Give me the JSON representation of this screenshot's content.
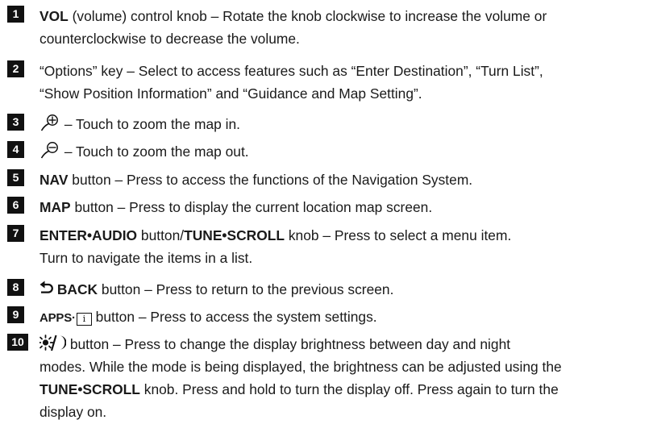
{
  "items": [
    {
      "num": "1",
      "bold": "VOL",
      "text": " (volume) control knob – Rotate the knob clockwise to increase the volume or",
      "text2": "counterclockwise to decrease the volume."
    },
    {
      "num": "2",
      "text": "“Options” key – Select to access features such as “Enter Destination”, “Turn List”,",
      "text2": "“Show Position Information” and “Guidance and Map Setting”."
    },
    {
      "num": "3",
      "icon": "zoom-in-icon",
      "text": " – Touch to zoom the map in."
    },
    {
      "num": "4",
      "icon": "zoom-out-icon",
      "text": " – Touch to zoom the map out."
    },
    {
      "num": "5",
      "bold": "NAV",
      "text": " button – Press to access the functions of the Navigation System."
    },
    {
      "num": "6",
      "bold": "MAP",
      "text": " button – Press to display the current location map screen."
    },
    {
      "num": "7",
      "bold": "ENTER•AUDIO",
      "mid": " button/",
      "bold2": "TUNE•SCROLL",
      "text": " knob – Press to select a menu item.",
      "text2": "Turn to navigate the items in a list."
    },
    {
      "num": "8",
      "icon": "back-arrow-icon",
      "bold": " BACK",
      "text": " button – Press to return to the previous screen."
    },
    {
      "num": "9",
      "bold": "APPS·",
      "icon_glyph": "i",
      "text": " button – Press to access the system settings."
    },
    {
      "num": "10",
      "icon": "day-night-icon",
      "text": " button – Press to change the display brightness between day and night",
      "text2": "modes. While the mode is being displayed, the brightness can be adjusted using the",
      "text3_bold": "TUNE•SCROLL",
      "text3": " knob. Press and hold to turn the display off. Press again to turn the",
      "text4": "display on."
    }
  ]
}
